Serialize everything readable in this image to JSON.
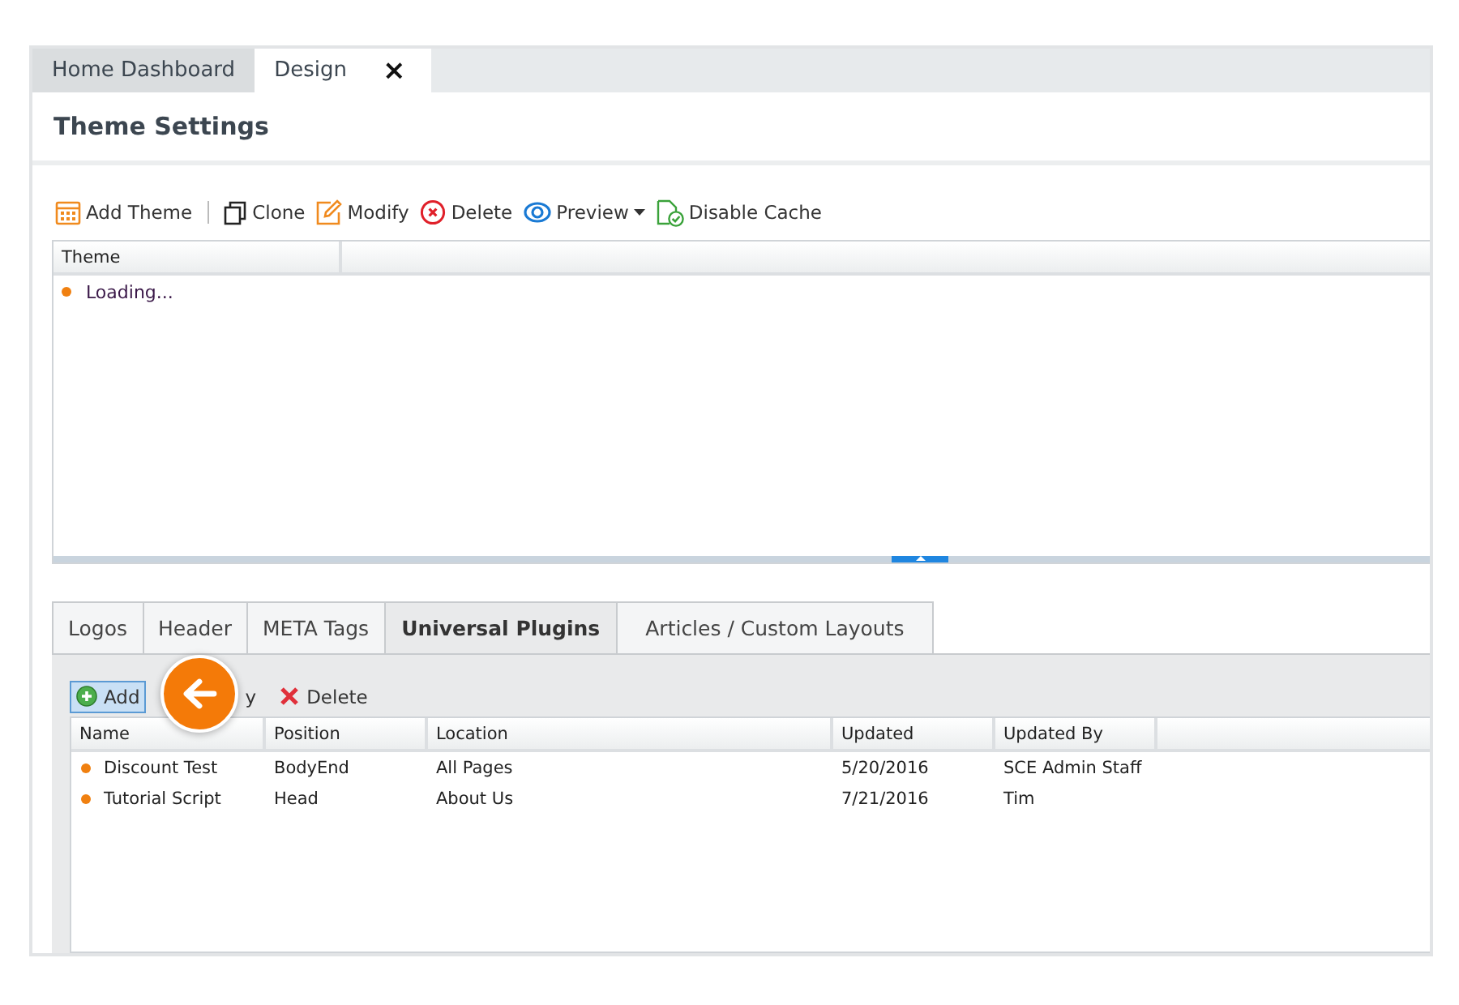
{
  "tabs": [
    {
      "label": "Home Dashboard",
      "selected": false,
      "closable": false
    },
    {
      "label": "Design",
      "selected": true,
      "closable": true,
      "close_glyph": "×"
    }
  ],
  "title": "Theme Settings",
  "toolbar": [
    {
      "kind": "calendar",
      "label": "Add Theme",
      "dropdown": false
    },
    {
      "kind": "clone",
      "label": "Clone",
      "dropdown": false
    },
    {
      "kind": "pencil",
      "label": "Modify",
      "dropdown": false
    },
    {
      "kind": "delete",
      "label": "Delete",
      "dropdown": false
    },
    {
      "kind": "eye",
      "label": "Preview",
      "dropdown": true
    },
    {
      "kind": "cache",
      "label": "Disable Cache",
      "dropdown": false
    }
  ],
  "theme_grid": {
    "columns": [
      "Theme"
    ],
    "rows": [
      {
        "text": "Loading...",
        "color": "#f08010"
      }
    ]
  },
  "section_tabs": [
    {
      "label": "Logos",
      "selected": false
    },
    {
      "label": "Header",
      "selected": false
    },
    {
      "label": "META Tags",
      "selected": false
    },
    {
      "label": "Universal Plugins",
      "selected": true
    },
    {
      "label": "Articles / Custom Layouts",
      "selected": false
    }
  ],
  "plugin_toolbar": [
    {
      "kind": "add",
      "label": "Add",
      "selected": true
    },
    {
      "kind": "modify",
      "label": "y",
      "selected": false
    },
    {
      "kind": "delete",
      "label": "Delete",
      "selected": false
    }
  ],
  "plugin_grid": {
    "columns": [
      "Name",
      "Position",
      "Location",
      "Updated",
      "Updated By"
    ],
    "rows": [
      {
        "color": "#f08010",
        "cells": [
          "Discount Test",
          "BodyEnd",
          "All Pages",
          "5/20/2016",
          "SCE Admin Staff"
        ]
      },
      {
        "color": "#f08010",
        "cells": [
          "Tutorial Script",
          "Head",
          "About Us",
          "7/21/2016",
          "Tim"
        ]
      }
    ]
  }
}
